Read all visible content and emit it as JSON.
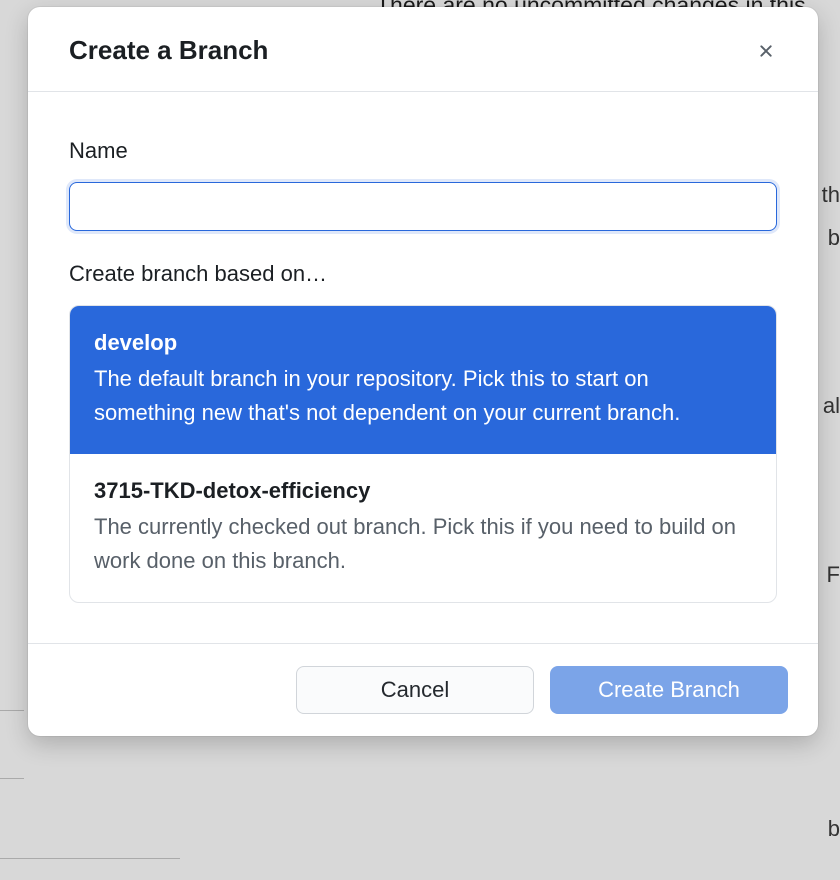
{
  "backdrop": {
    "status_text": "There are no uncommitted changes in this",
    "side_chars": [
      "th",
      "b",
      "al",
      "F",
      "b"
    ]
  },
  "modal": {
    "title": "Create a Branch",
    "name_label": "Name",
    "name_value": "",
    "based_on_label": "Create branch based on…",
    "options": [
      {
        "name": "develop",
        "description": "The default branch in your repository. Pick this to start on something new that's not dependent on your current branch.",
        "selected": true
      },
      {
        "name": "3715-TKD-detox-efficiency",
        "description": "The currently checked out branch. Pick this if you need to build on work done on this branch.",
        "selected": false
      }
    ],
    "cancel_label": "Cancel",
    "submit_label": "Create Branch"
  }
}
